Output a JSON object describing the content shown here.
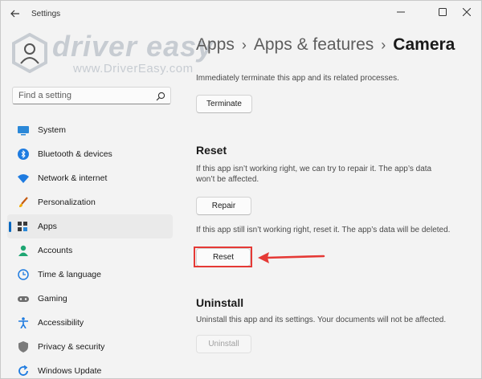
{
  "window": {
    "title": "Settings",
    "controls": [
      "minimize",
      "maximize",
      "close"
    ]
  },
  "watermark": {
    "brand": "driver easy",
    "url": "www.DriverEasy.com"
  },
  "search": {
    "placeholder": "Find a setting"
  },
  "sidebar": {
    "items": [
      {
        "label": "System",
        "icon": "system-icon"
      },
      {
        "label": "Bluetooth & devices",
        "icon": "bluetooth-icon"
      },
      {
        "label": "Network & internet",
        "icon": "wifi-icon"
      },
      {
        "label": "Personalization",
        "icon": "brush-icon"
      },
      {
        "label": "Apps",
        "icon": "apps-icon",
        "selected": true
      },
      {
        "label": "Accounts",
        "icon": "person-icon"
      },
      {
        "label": "Time & language",
        "icon": "globe-clock-icon"
      },
      {
        "label": "Gaming",
        "icon": "gamepad-icon"
      },
      {
        "label": "Accessibility",
        "icon": "accessibility-icon"
      },
      {
        "label": "Privacy & security",
        "icon": "shield-icon"
      },
      {
        "label": "Windows Update",
        "icon": "update-icon"
      }
    ]
  },
  "breadcrumb": {
    "items": [
      "Apps",
      "Apps & features"
    ],
    "current": "Camera",
    "separator": "›"
  },
  "main": {
    "terminate": {
      "desc": "Immediately terminate this app and its related processes.",
      "button": "Terminate"
    },
    "reset": {
      "heading": "Reset",
      "repair_desc_1": "If this app isn’t working right, we can try to repair it. The app’s data",
      "repair_desc_2": "won’t be affected.",
      "repair_button": "Repair",
      "reset_desc": "If this app still isn’t working right, reset it. The app’s data will be deleted.",
      "reset_button": "Reset"
    },
    "uninstall": {
      "heading": "Uninstall",
      "desc": "Uninstall this app and its settings. Your documents will not be affected.",
      "button": "Uninstall"
    }
  },
  "colors": {
    "accent": "#0067c0",
    "annotation": "#e53935",
    "background": "#f3f3f3"
  }
}
